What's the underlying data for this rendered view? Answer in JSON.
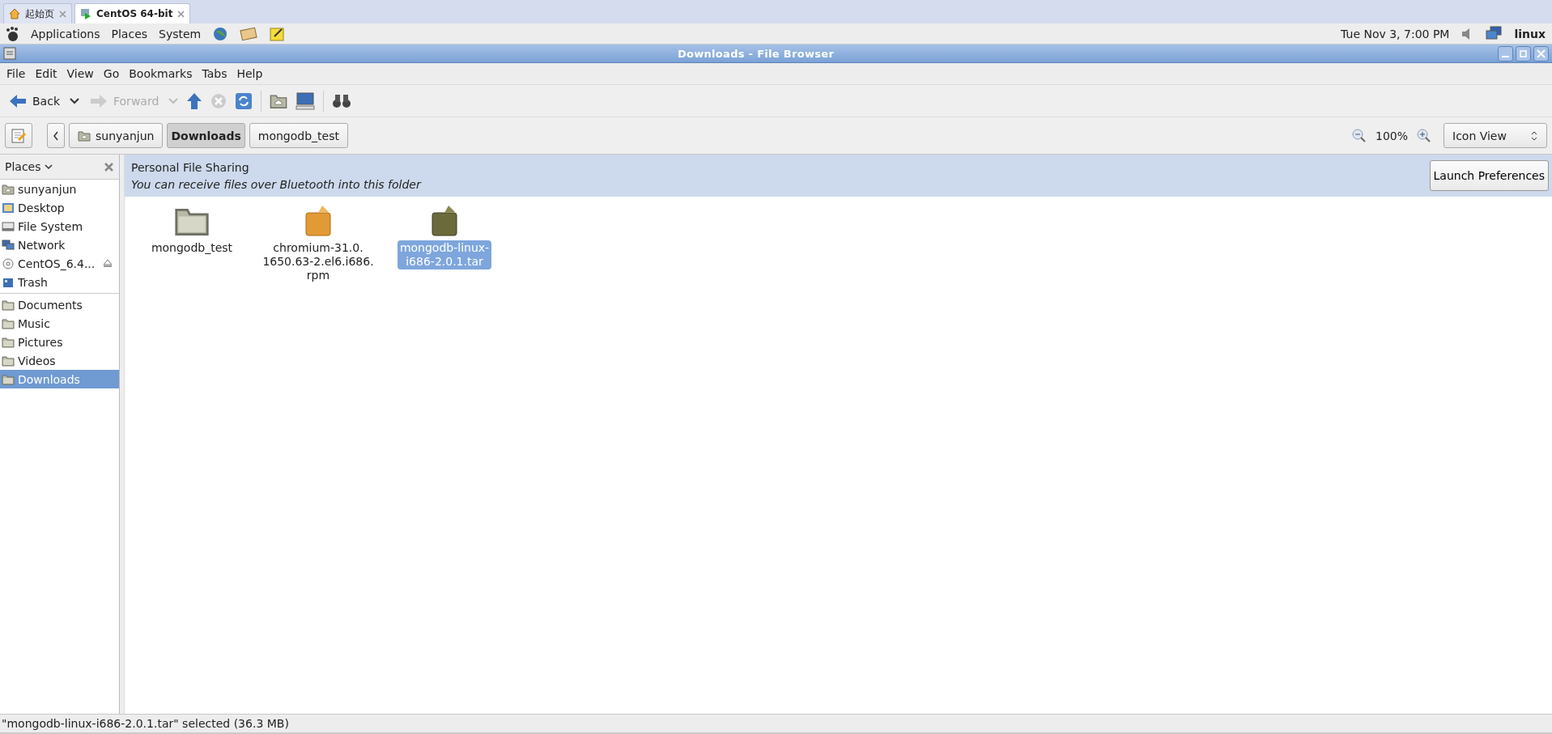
{
  "browser_tabs": [
    {
      "label": "起始页",
      "kind": "home",
      "selected": false
    },
    {
      "label": "CentOS 64-bit",
      "kind": "vm",
      "selected": true
    }
  ],
  "top_panel": {
    "menus": [
      "Applications",
      "Places",
      "System"
    ],
    "clock": "Tue Nov  3,  7:00 PM",
    "user": "linux"
  },
  "window": {
    "title": "Downloads - File Browser"
  },
  "menu_bar": [
    "File",
    "Edit",
    "View",
    "Go",
    "Bookmarks",
    "Tabs",
    "Help"
  ],
  "toolbar": {
    "back": {
      "label": "Back",
      "disabled": false
    },
    "forward": {
      "label": "Forward",
      "disabled": true
    }
  },
  "location": {
    "crumbs": [
      {
        "label": "sunyanjun",
        "kind": "home",
        "selected": false
      },
      {
        "label": "Downloads",
        "kind": "plain",
        "selected": true
      },
      {
        "label": "mongodb_test",
        "kind": "plain",
        "selected": false
      }
    ],
    "zoom": "100%",
    "view": "Icon View"
  },
  "sidebar": {
    "title": "Places",
    "devices": [
      {
        "label": "sunyanjun",
        "kind": "home",
        "ejectable": false,
        "selected": false
      },
      {
        "label": "Desktop",
        "kind": "desktop",
        "ejectable": false,
        "selected": false
      },
      {
        "label": "File System",
        "kind": "drive",
        "ejectable": false,
        "selected": false
      },
      {
        "label": "Network",
        "kind": "network",
        "ejectable": false,
        "selected": false
      },
      {
        "label": "CentOS_6.4...",
        "kind": "disc",
        "ejectable": true,
        "selected": false
      },
      {
        "label": "Trash",
        "kind": "trash",
        "ejectable": false,
        "selected": false
      }
    ],
    "bookmarks": [
      {
        "label": "Documents",
        "kind": "folder",
        "selected": false
      },
      {
        "label": "Music",
        "kind": "folder",
        "selected": false
      },
      {
        "label": "Pictures",
        "kind": "folder",
        "selected": false
      },
      {
        "label": "Videos",
        "kind": "folder",
        "selected": false
      },
      {
        "label": "Downloads",
        "kind": "folder",
        "selected": true
      }
    ]
  },
  "info_bar": {
    "title": "Personal File Sharing",
    "message": "You can receive files over Bluetooth into this folder",
    "button": "Launch Preferences"
  },
  "files": [
    {
      "name_lines": [
        "mongodb_test"
      ],
      "kind": "folder",
      "selected": false
    },
    {
      "name_lines": [
        "chromium-31.0.",
        "1650.63-2.el6.i686.",
        "rpm"
      ],
      "kind": "package",
      "selected": false
    },
    {
      "name_lines": [
        "mongodb-linux-",
        "i686-2.0.1.tar"
      ],
      "kind": "package",
      "selected": true
    }
  ],
  "status_bar": "\"mongodb-linux-i686-2.0.1.tar\" selected (36.3 MB)"
}
